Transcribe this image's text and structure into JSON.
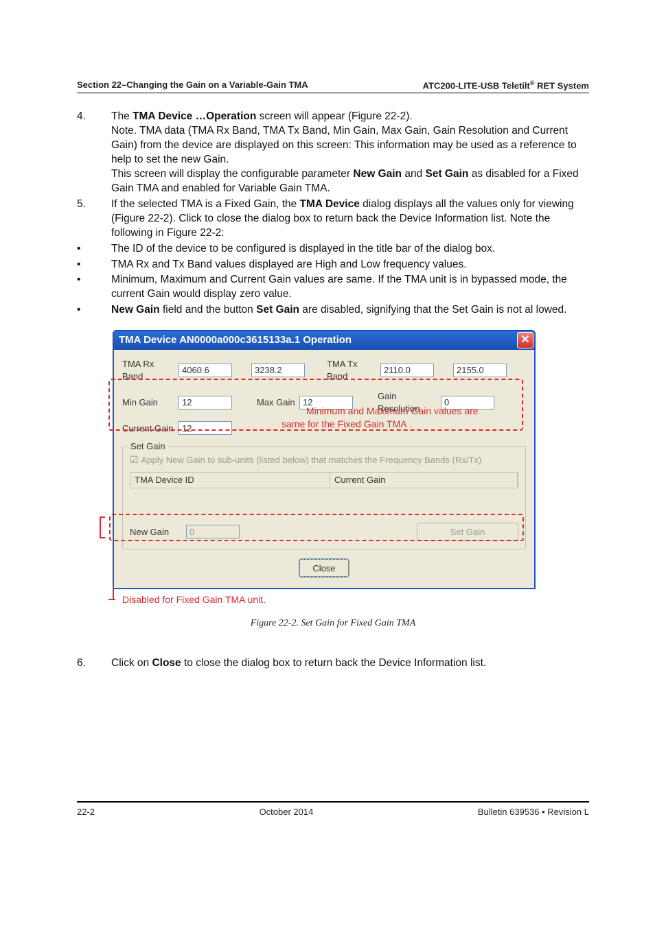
{
  "header": {
    "left": "Section 22–Changing the Gain on a Variable-Gain TMA",
    "right_prefix": "ATC200-LITE-USB Teletilt",
    "right_reg": "®",
    "right_suffix": " RET System"
  },
  "items": [
    {
      "num": "4.",
      "paras": [
        "The <b>TMA Device …Operation</b> screen will appear (Figure 22-2).",
        "Note. TMA data (TMA Rx Band, TMA Tx Band, Min Gain, Max Gain, Gain Resolution and Current Gain) from the device are displayed on this screen: This information may be used as a reference to help to set the new Gain.",
        "This screen will display the configurable parameter <b>New Gain</b> and <b>Set Gain</b> as disabled for a Fixed Gain TMA and enabled for Variable Gain TMA."
      ]
    },
    {
      "num": "5.",
      "paras": [
        "If the selected TMA is a Fixed Gain, the <b>TMA Device</b> dialog displays all the values only for viewing (Figure 22-2). Click to close the dialog box to return back the Device Information list. Note the following in Figure 22-2:"
      ]
    }
  ],
  "bullets": [
    "The ID of the device to be configured is displayed in the title bar of the dialog box.",
    "TMA Rx and Tx Band values displayed are High and Low frequency values.",
    "Minimum, Maximum and Current Gain values are same. If the TMA unit is in bypassed mode, the current Gain would display zero value.",
    "<b>New Gain</b> field and the button <b>Set Gain</b> are disabled, signifying that the Set Gain is not al lowed."
  ],
  "dialog": {
    "title": "TMA Device AN0000a000c3615133a.1 Operation",
    "rx_label": "TMA Rx Band",
    "rx_hi": "4060.6",
    "rx_lo": "3238.2",
    "tx_label": "TMA Tx Band",
    "tx_hi": "2110.0",
    "tx_lo": "2155.0",
    "min_label": "Min Gain",
    "min_val": "12",
    "max_label": "Max Gain",
    "max_val": "12",
    "res_label": "Gain Resolution",
    "res_val": "0",
    "cur_label": "Current Gain",
    "cur_val": "12",
    "set_legend": "Set Gain",
    "apply_text": "Apply New Gain to sub-units (listed below) that matches the Frequency Bands (Rx/Tx)",
    "col1": "TMA Device ID",
    "col2": "Current Gain",
    "new_label": "New Gain",
    "new_val": "0",
    "set_btn": "Set Gain",
    "close_btn": "Close",
    "annot1a": "Minimum and Maximum Gain values are",
    "annot1b": "same for the Fixed Gain TMA .",
    "annot2": "Disabled  for Fixed Gain TMA unit."
  },
  "fig_caption": "Figure 22-2. Set Gain for Fixed Gain TMA",
  "item6": {
    "num": "6.",
    "text": "Click on <b>Close</b> to close the dialog box to return back the Device Information list."
  },
  "footer": {
    "left": "22-2",
    "mid": "October 2014",
    "right": "Bulletin 639536  •  Revision L"
  }
}
